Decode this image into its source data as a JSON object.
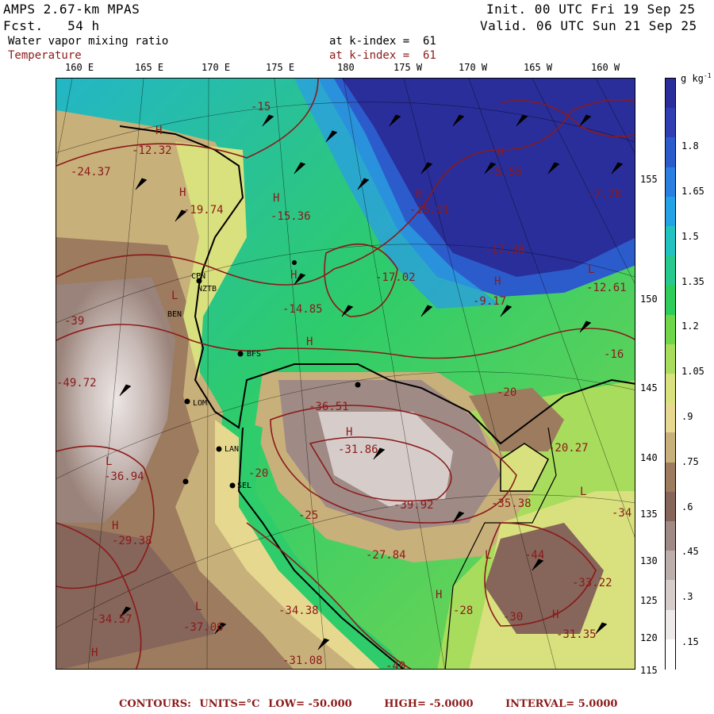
{
  "header": {
    "model": "AMPS 2.67-km MPAS",
    "fcst": "Fcst.   54 h",
    "init": "Init. 00 UTC Fri 19 Sep 25",
    "valid": "Valid. 06 UTC Sun 21 Sep 25",
    "field1": "Water vapor mixing ratio",
    "field1_level": "at k-index =  61",
    "field2": "Temperature",
    "field2_level": "at k-index =  61"
  },
  "longitudes": [
    "160 E",
    "165 E",
    "170 E",
    "175 E",
    "180",
    "175 W",
    "170 W",
    "165 W",
    "160 W"
  ],
  "latitudes": [
    "155",
    "150",
    "145",
    "140",
    "135",
    "130",
    "125",
    "120",
    "115"
  ],
  "colorbar": {
    "unit": "g kg",
    "unit_exp": "-1",
    "labels": [
      "1.8",
      "1.65",
      "1.5",
      "1.35",
      "1.2",
      "1.05",
      ".9",
      ".75",
      ".6",
      ".45",
      ".3",
      ".15"
    ],
    "colors": [
      "#2a2e9a",
      "#2f3fb3",
      "#2c5ccc",
      "#2b7fe0",
      "#23a3e6",
      "#22c2c0",
      "#27c98f",
      "#2ecc5a",
      "#6fd64a",
      "#a8dc5c",
      "#d9e07e",
      "#e6d98f",
      "#c8b07a",
      "#9c7b5e",
      "#86655a",
      "#9f8a85",
      "#bcaeab",
      "#d6cdcb",
      "#eeeaea",
      "#ffffff"
    ]
  },
  "contour_labels": [
    "-12.32",
    "-24.37",
    "-19.74",
    "-15.36",
    "-14.85",
    "-17.02",
    "-15.91",
    "-5.55",
    "-7.78",
    "-17.38",
    "-9.17",
    "-12.61",
    "-16",
    "-20",
    "-36.51",
    "-31.86",
    "-39.92",
    "-35.38",
    "-20.27",
    "-36.94",
    "-29.38",
    "-27.84",
    "-34.57",
    "-37.06",
    "-34.38",
    "-31.08",
    "-30",
    "-28",
    "-44",
    "-33.22",
    "-31.35",
    "-49.72",
    "-39",
    "-20",
    "-25",
    "-34",
    "-40",
    "-15"
  ],
  "stations": [
    "CPN",
    "NZTB",
    "BFS",
    "LAN",
    "SEL",
    "BEN",
    "LOM"
  ],
  "footer": {
    "contours": "CONTOURS:",
    "units": "UNITS=°C",
    "low": "LOW= -50.000",
    "high": "HIGH= -5.0000",
    "interval": "INTERVAL=   5.0000"
  }
}
